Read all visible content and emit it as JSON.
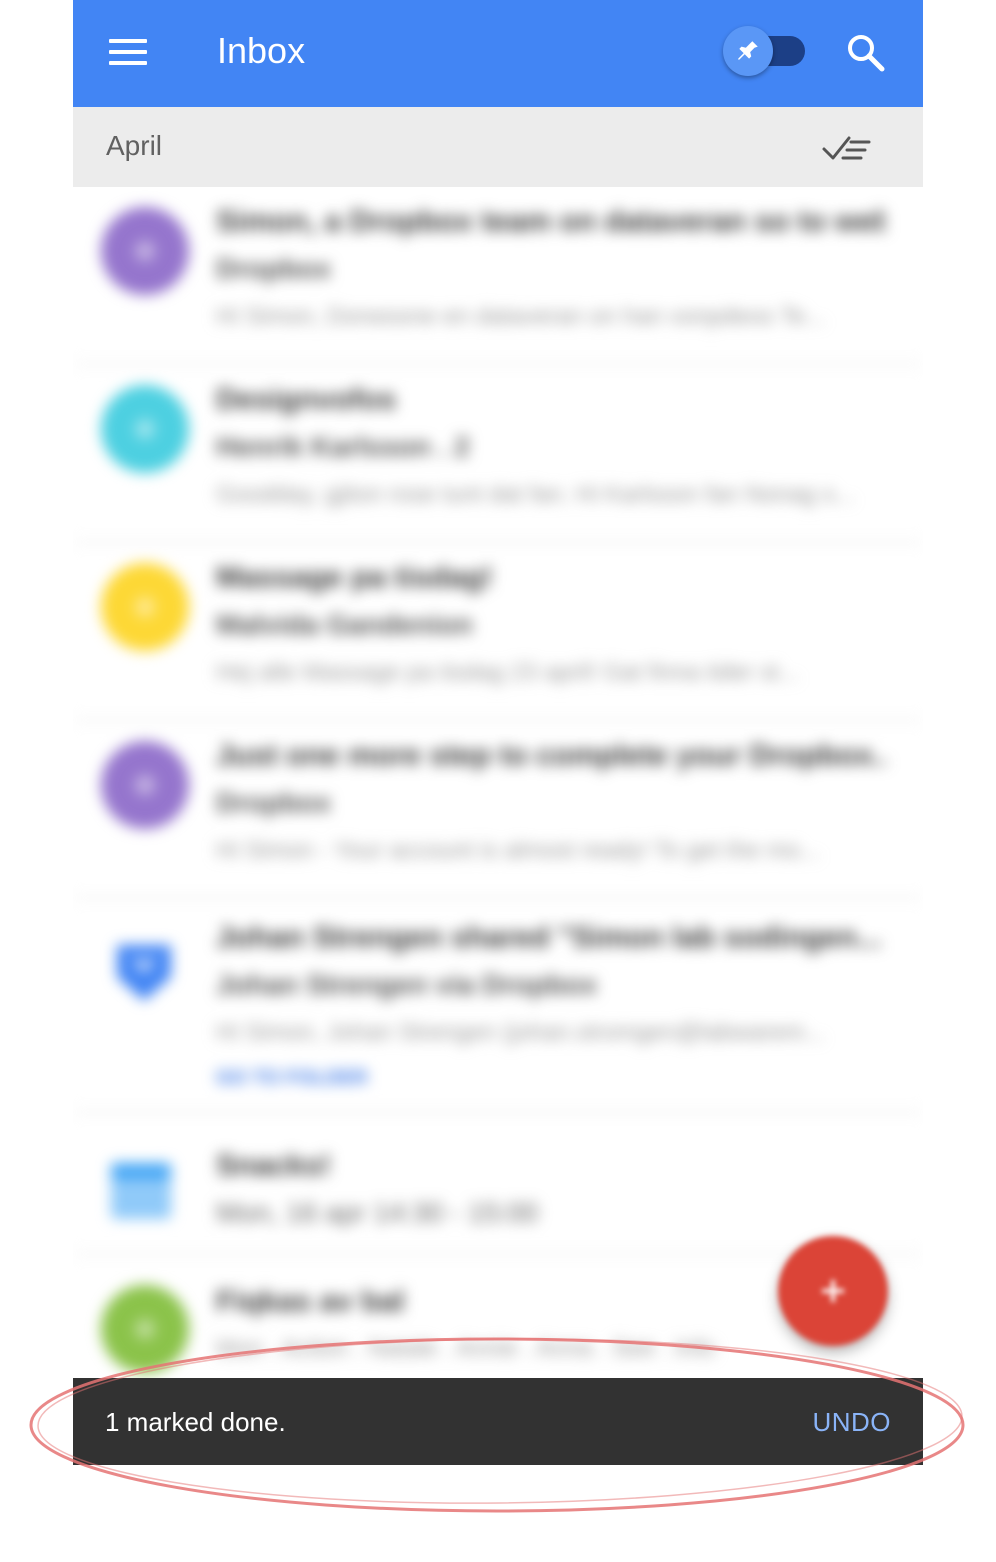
{
  "appbar": {
    "title": "Inbox",
    "color": "#4285f4",
    "menu_icon": "menu-icon",
    "pin_toggle_icon": "pin-icon",
    "search_icon": "search-icon"
  },
  "section": {
    "label": "April",
    "sweep_icon": "sweep-done-icon"
  },
  "list": {
    "items": [
      {
        "title": "Simon, a Dropbox team on dataveran so to web...",
        "sender": "Dropbox",
        "snippet": "Hi Simon, Dorwoone en dataveran on han vonpdeos Te...",
        "avatar_color": "#9575cd"
      },
      {
        "title": "Designvofos",
        "sender": "Henrik Karlsson . 2",
        "snippet": "Goodday, gjiton rose tunt dat fan. Hi Karlsson fan Nonag s...",
        "avatar_color": "#4dd0e1"
      },
      {
        "title": "Massage pa tisdag!",
        "sender": "Malvida Gandenion",
        "snippet": "Hej alle Massage pa tisdag 23 april! Gat finna tider st...",
        "avatar_color": "#fdd835"
      },
      {
        "title": "Just one more step to complete your Dropbox...",
        "sender": "Dropbox",
        "snippet": "Hi Simon - Your account is almost ready! To get the mo...",
        "avatar_color": "#9575cd"
      },
      {
        "title": "Johan Strengen shared \"Simon lab sodingen...",
        "sender": "Johan Strengen via Dropbox",
        "snippet": "Hi Simon, Johan Strengen (johan.stromgen@labwarem...",
        "link": "GO TO FOLDER",
        "avatar_color": "#4285f4"
      },
      {
        "title": "Snacks!",
        "sender": "Mon, 16 apr 14:30 - 15:00",
        "avatar_color": "#64b5f6"
      },
      {
        "title": "Fiqkas av bal",
        "sender": "Mon . Action . Natale . Annie . Anna . See . Info",
        "avatar_color": "#8bc34a"
      }
    ]
  },
  "fab": {
    "icon": "plus-icon",
    "color": "#db4437"
  },
  "snackbar": {
    "message": "1 marked done.",
    "action": "UNDO"
  },
  "annotation": {
    "color": "#e57373"
  }
}
